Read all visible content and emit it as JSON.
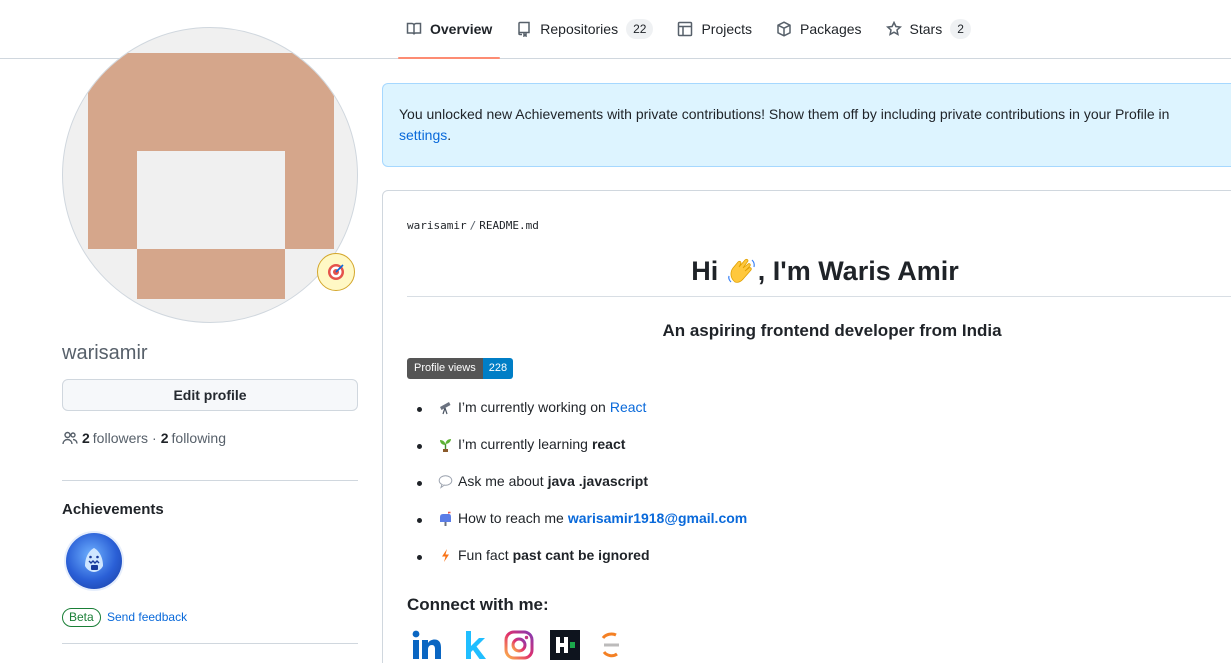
{
  "nav": {
    "tabs": [
      {
        "label": "Overview",
        "icon": "book-icon"
      },
      {
        "label": "Repositories",
        "count": "22",
        "icon": "repo-icon"
      },
      {
        "label": "Projects",
        "icon": "table-icon"
      },
      {
        "label": "Packages",
        "icon": "package-icon"
      },
      {
        "label": "Stars",
        "count": "2",
        "icon": "star-icon"
      }
    ]
  },
  "profile": {
    "username": "warisamir",
    "edit_label": "Edit profile",
    "followers_count": "2",
    "followers_label": "followers",
    "separator": "·",
    "following_count": "2",
    "following_label": "following",
    "achievements_title": "Achievements",
    "beta_label": "Beta",
    "feedback_label": "Send feedback"
  },
  "notice": {
    "text": "You unlocked new Achievements with private contributions! Show them off by including private contributions in your Profile in ",
    "link": "settings",
    "end": "."
  },
  "readme": {
    "owner": "warisamir",
    "sep": "/",
    "file": "README.md",
    "heading_pre": "Hi ",
    "heading_post": ", I'm Waris Amir",
    "subtitle": "An aspiring frontend developer from India",
    "views_label": "Profile views",
    "views_count": "228",
    "items": [
      {
        "text": "I’m currently working on",
        "link": "React"
      },
      {
        "text": "I’m currently learning",
        "bold": "react"
      },
      {
        "text": "Ask me about",
        "bold": "java .javascript"
      },
      {
        "text": "How to reach me",
        "link": "warisamir1918@gmail.com"
      },
      {
        "text": "Fun fact",
        "bold": "past cant be ignored"
      }
    ],
    "connect": "Connect with me:"
  },
  "colors": {
    "accent_underline": "#fd8c73",
    "link": "#0969da",
    "notice_bg": "#ddf4ff",
    "avatar_block": "#d5a68b"
  }
}
